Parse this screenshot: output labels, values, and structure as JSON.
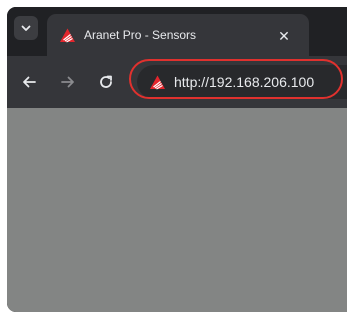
{
  "tab": {
    "title": "Aranet Pro - Sensors",
    "close_glyph": "✕",
    "favicon": "aranet-logo-icon"
  },
  "toolbar": {
    "back": "arrow-left-icon",
    "forward": "arrow-right-icon",
    "reload": "reload-icon"
  },
  "address_bar": {
    "url": "http://192.168.206.100",
    "favicon": "aranet-logo-icon"
  },
  "colors": {
    "frame": "#202124",
    "toolbar": "#35363a",
    "highlight": "#e0312e",
    "content": "#838584",
    "brand": "#e3262d"
  }
}
